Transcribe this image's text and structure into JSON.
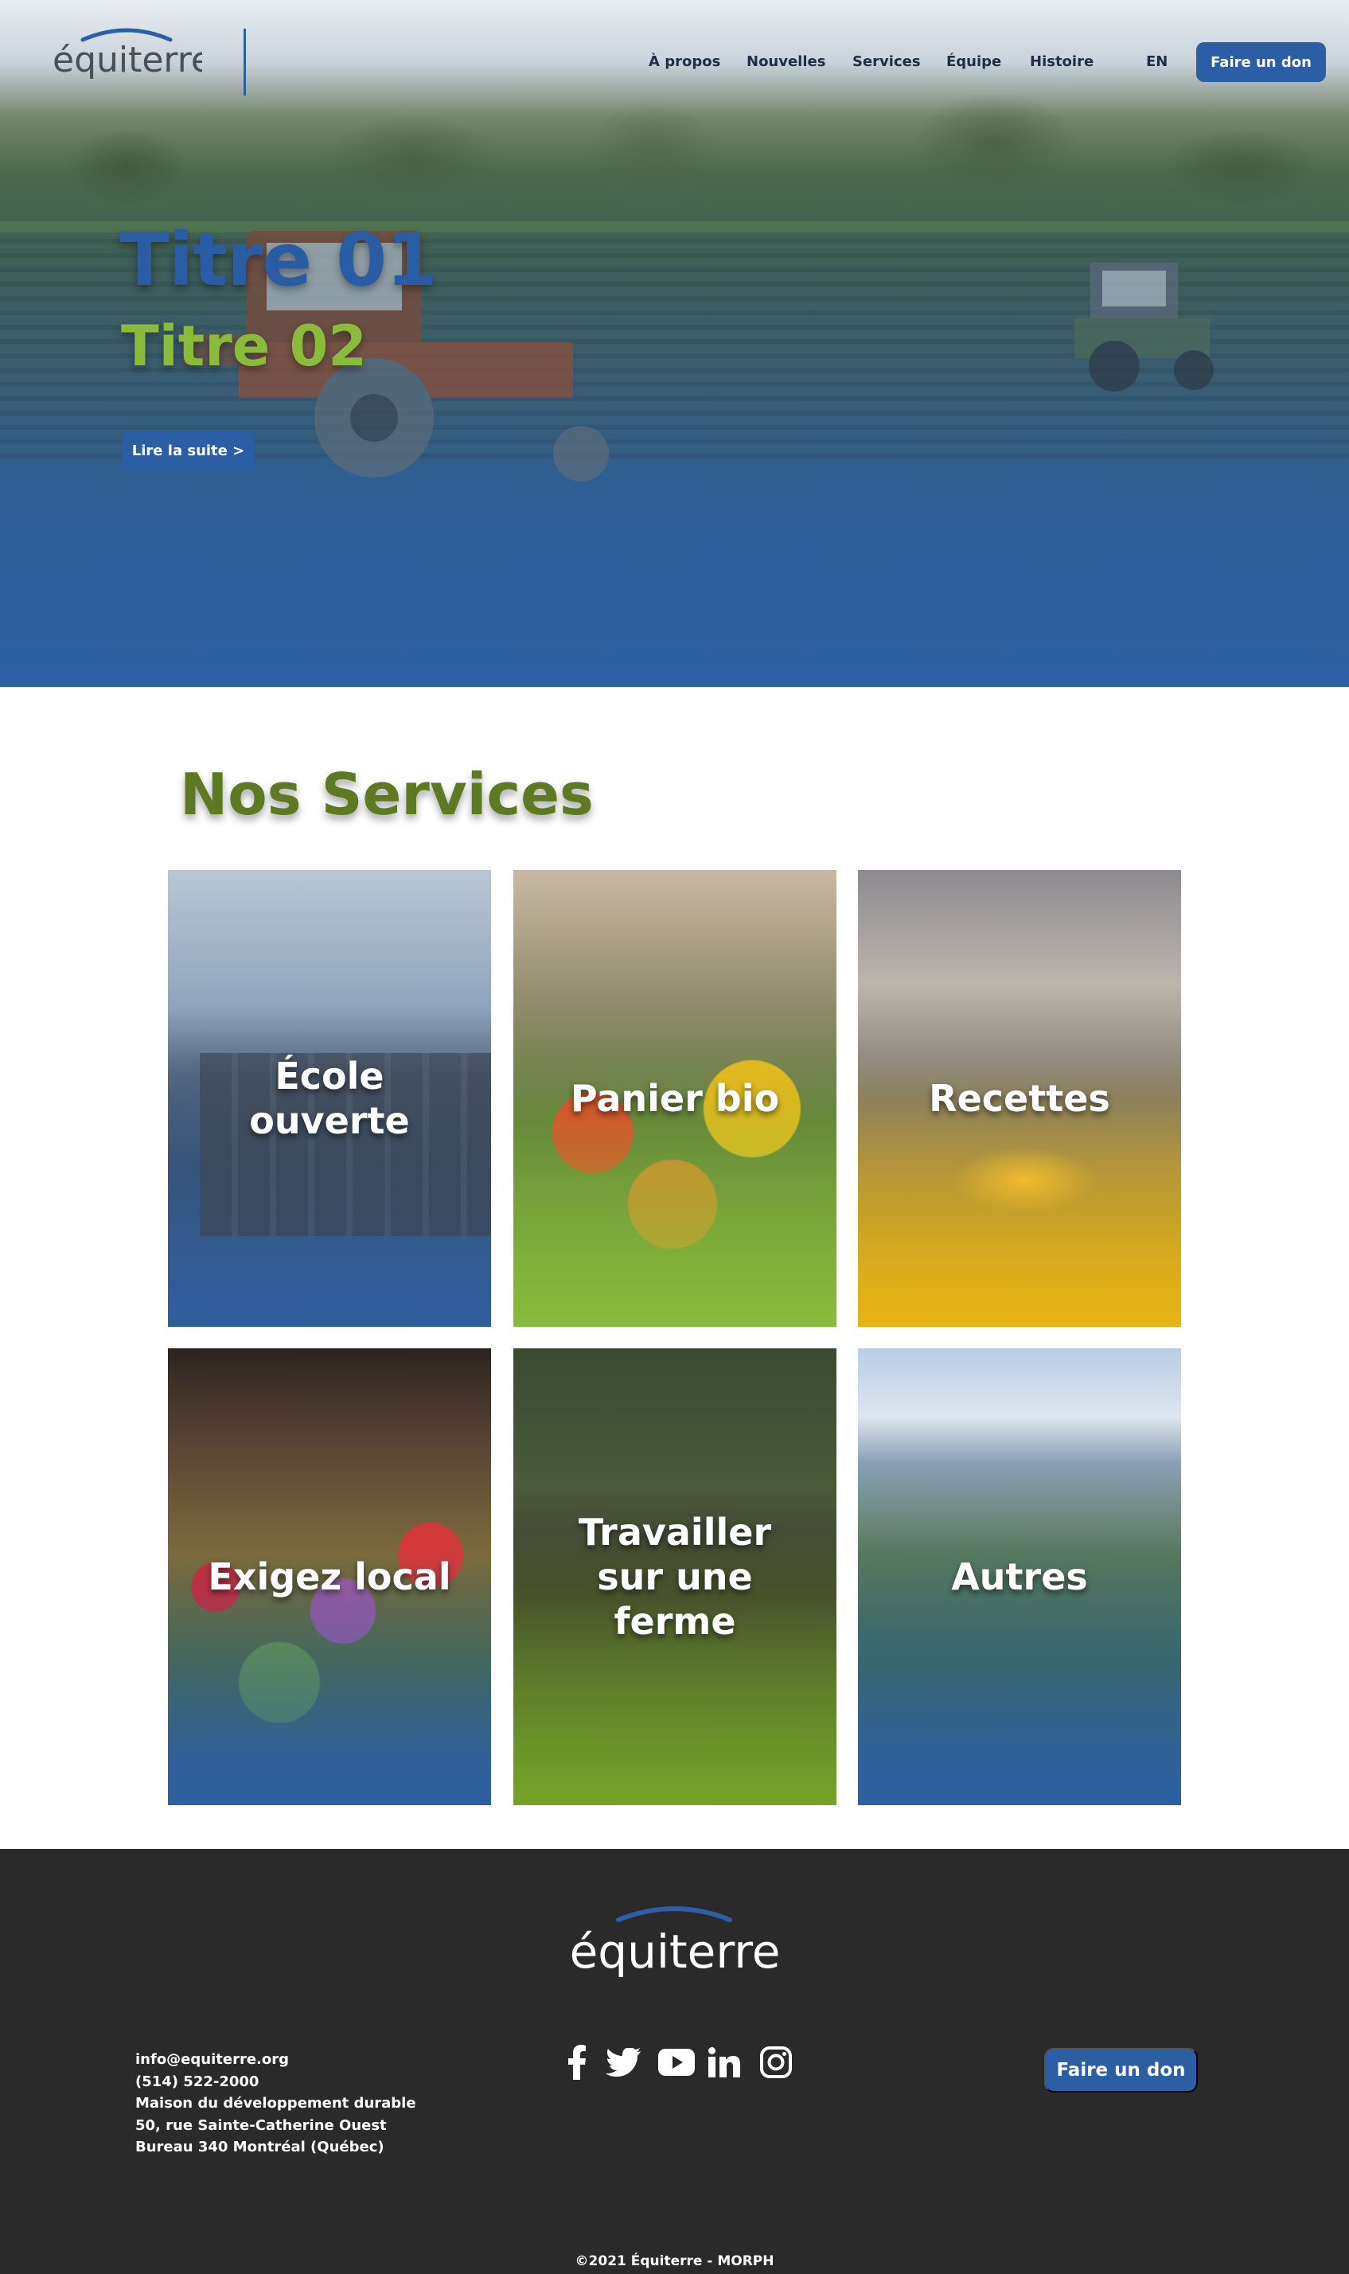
{
  "header": {
    "logo_text": "équiterre",
    "nav": [
      {
        "label": "À propos"
      },
      {
        "label": "Nouvelles"
      },
      {
        "label": "Services"
      },
      {
        "label": "Équipe"
      },
      {
        "label": "Histoire"
      }
    ],
    "language_toggle": "EN",
    "donate_label": "Faire un don"
  },
  "hero": {
    "title1": "Titre 01",
    "title2": "Titre 02",
    "cta_label": "Lire la suite >"
  },
  "services": {
    "title": "Nos Services",
    "cards": [
      {
        "label": "École ouverte"
      },
      {
        "label": "Panier bio"
      },
      {
        "label": "Recettes"
      },
      {
        "label": "Exigez local"
      },
      {
        "label": "Travailler sur une ferme"
      },
      {
        "label": "Autres"
      }
    ]
  },
  "footer": {
    "logo_text": "équiterre",
    "contact": [
      "info@equiterre.org",
      "(514) 522-2000",
      "Maison du développement durable",
      "50, rue Sainte-Catherine Ouest",
      "Bureau 340 Montréal (Québec)"
    ],
    "social_icons": [
      "facebook-icon",
      "twitter-icon",
      "youtube-icon",
      "linkedin-icon",
      "instagram-icon"
    ],
    "donate_label": "Faire un don",
    "copyright": "©2021 Équiterre - MORPH"
  },
  "colors": {
    "brand_blue": "#2b5ea4",
    "brand_green": "#8bbb3b",
    "services_title_green": "#5d7a22",
    "footer_bg": "#2a2a2a"
  }
}
